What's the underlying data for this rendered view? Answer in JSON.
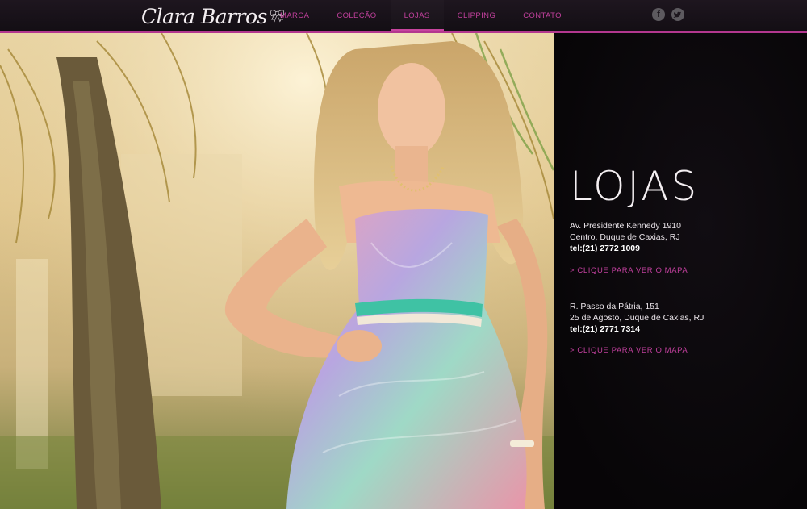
{
  "header": {
    "logo_text": "Clara Barros",
    "nav": [
      "MARCA",
      "COLEÇÃO",
      "LOJAS",
      "CLIPPING",
      "CONTATO"
    ],
    "active_nav": "LOJAS",
    "social": {
      "facebook": "f",
      "twitter": "t"
    }
  },
  "panel": {
    "title": "LOJAS",
    "stores": [
      {
        "address_line1": "Av. Presidente Kennedy 1910",
        "address_line2": "Centro, Duque de Caxias, RJ",
        "phone": "tel:(21) 2772 1009",
        "map_link": "> CLIQUE PARA VER O MAPA"
      },
      {
        "address_line1": "R. Passo da Pátria, 151",
        "address_line2": "25 de Agosto, Duque de Caxias, RJ",
        "phone": "tel:(21) 2771 7314",
        "map_link": "> CLIQUE PARA VER O MAPA"
      }
    ]
  },
  "colors": {
    "accent": "#c1409c",
    "bar": "#1a131b",
    "panel": "#0a070b"
  },
  "icons": [
    "bow-icon",
    "facebook-icon",
    "twitter-icon"
  ]
}
